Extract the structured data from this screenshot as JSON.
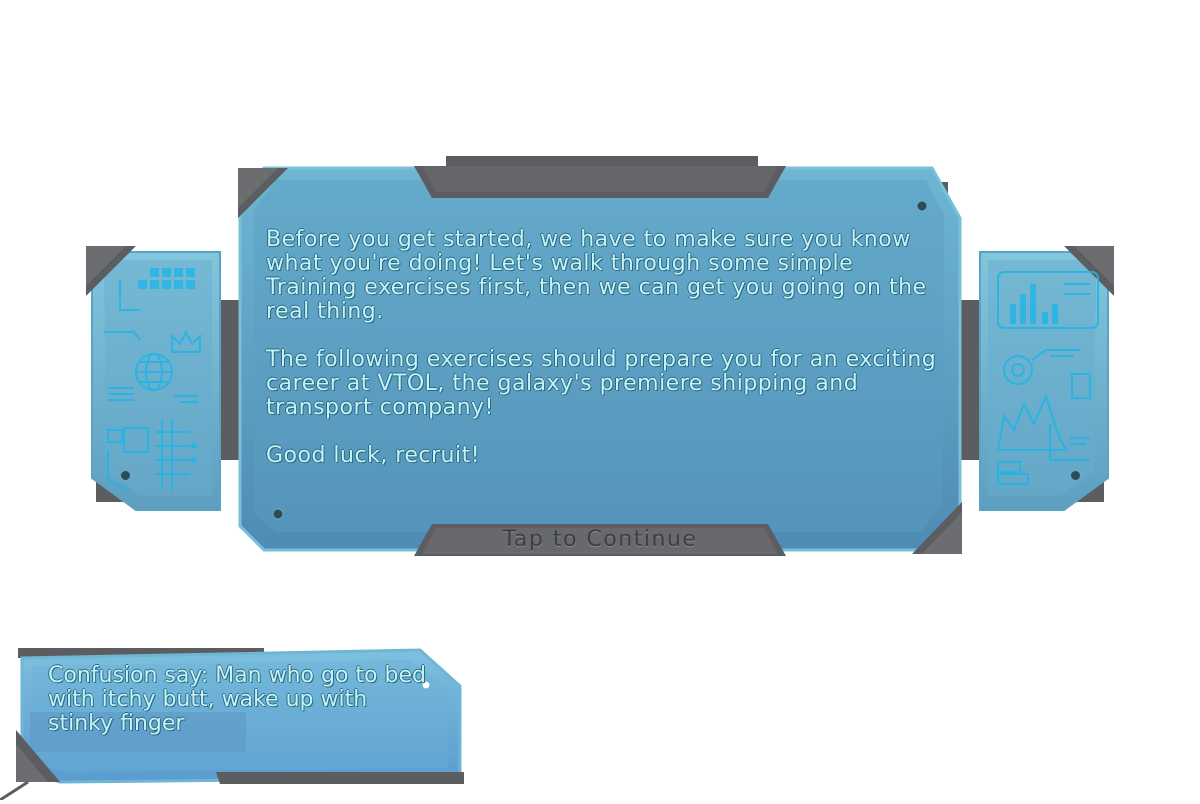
{
  "dialog": {
    "paragraphs": [
      "Before you get started, we have to make sure you know what you're doing! Let's walk through some simple Training exercises first, then we can get you going on the real thing.",
      "The following exercises should prepare you for an exciting career at VTOL, the galaxy's premiere shipping and transport company!",
      "Good luck, recruit!"
    ],
    "continue_label": "Tap to Continue"
  },
  "tip_panel": {
    "text": "Confusion say: Man who go to bed with itchy butt, wake up with stinky finger"
  },
  "side_panels": {
    "left_icons": [
      "grid-icon",
      "crown-icon",
      "globe-icon",
      "list-icon",
      "circuit-icon"
    ],
    "right_icons": [
      "bar-chart-icon",
      "target-icon",
      "mountain-chart-icon",
      "list-icon",
      "circuit-icon"
    ]
  },
  "colors": {
    "glass_light": "#7ec3db",
    "glass_dark": "#4d8fb0",
    "steel": "#5b5d60",
    "text": "#c8f2fa",
    "circuit": "#1fb5e8"
  }
}
